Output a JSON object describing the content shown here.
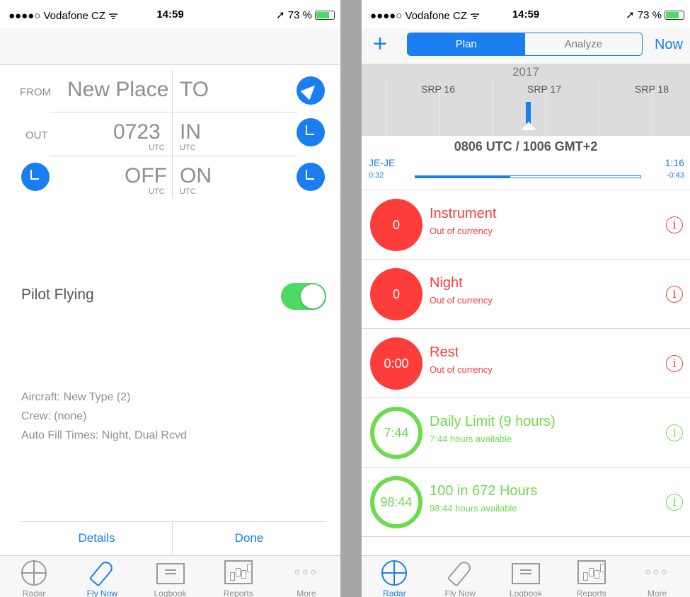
{
  "status_bar": {
    "carrier": "●●●●○ Vodafone CZ ᯤ",
    "time": "14:59",
    "battery": "➚ 73 %",
    "battery_level_pct": 73
  },
  "left": {
    "from_label": "FROM",
    "from_value": "New Place",
    "to_label": "TO",
    "out_label": "OUT",
    "out_value": "0723",
    "out_unit": "UTC",
    "in_label": "IN",
    "in_unit": "UTC",
    "off_label": "OFF",
    "off_unit": "UTC",
    "on_label": "ON",
    "on_unit": "UTC",
    "pilot_flying_label": "Pilot Flying",
    "pilot_flying_on": true,
    "aircraft": "Aircraft: New Type (2)",
    "crew": "Crew: (none)",
    "auto_fill": "Auto Fill Times: Night, Dual Rcvd",
    "details_label": "Details",
    "done_label": "Done"
  },
  "right": {
    "add_label": "+",
    "segments": [
      "Plan",
      "Analyze"
    ],
    "active_segment": "Plan",
    "now_label": "Now",
    "timeline": {
      "year": "2017",
      "markers": [
        "SRP 16",
        "SRP 17",
        "SRP 18"
      ]
    },
    "utc_line": "0806 UTC / 1006 GMT+2",
    "route": "JE-JE",
    "elapsed": "0:32",
    "total": "1:16",
    "remaining": "-0:43",
    "progress_fraction": 0.42,
    "rows": [
      {
        "value": "0",
        "title": "Instrument",
        "subtitle": "Out of currency",
        "status": "red"
      },
      {
        "value": "0",
        "title": "Night",
        "subtitle": "Out of currency",
        "status": "red"
      },
      {
        "value": "0:00",
        "title": "Rest",
        "subtitle": "Out of currency",
        "status": "red"
      },
      {
        "value": "7:44",
        "title": "Daily Limit (9 hours)",
        "subtitle": "7:44 hours available",
        "status": "green"
      },
      {
        "value": "98:44",
        "title": "100 in 672 Hours",
        "subtitle": "98:44 hours available",
        "status": "green"
      }
    ]
  },
  "tabs": [
    "Radar",
    "Fly Now",
    "Logbook",
    "Reports",
    "More"
  ],
  "tab_icons": [
    "radar-icon",
    "rocket-icon",
    "logbook-icon",
    "reports-icon",
    "more-icon"
  ],
  "left_active_tab": "Fly Now",
  "right_active_tab": "Radar",
  "colors": {
    "accent": "#1a7ef0",
    "danger": "#fc3d39",
    "ok": "#6ddb4c",
    "toggle_on": "#4cd964"
  }
}
